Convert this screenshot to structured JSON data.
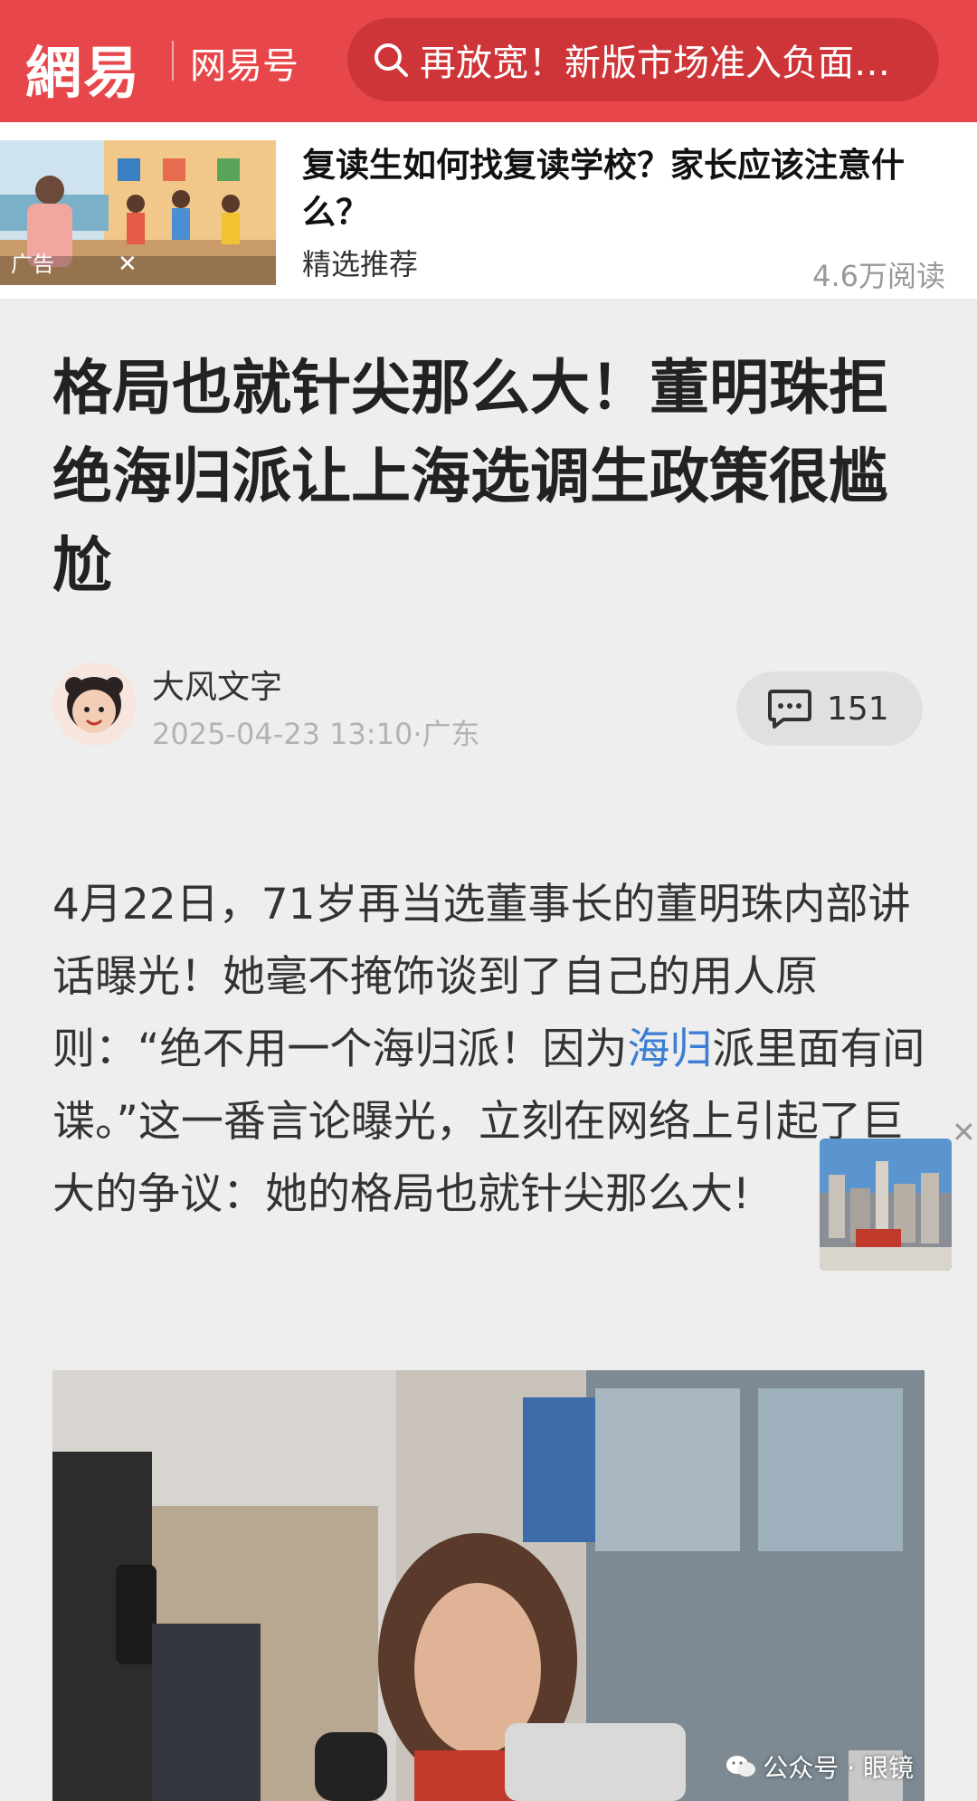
{
  "header": {
    "logo": "網易",
    "channel": "网易号",
    "search_text": "再放宽！新版市场准入负面…"
  },
  "ad": {
    "tag": "广告",
    "close": "✕",
    "title": "复读生如何找复读学校？家长应该注意什么？",
    "source": "精选推荐",
    "reads": "4.6万阅读"
  },
  "article": {
    "title": "格局也就针尖那么大！董明珠拒绝海归派让上海选调生政策很尴尬",
    "author": "大风文字",
    "meta": "2025-04-23 13:10·广东",
    "comment_count": "151",
    "body_before_link": "4月22日，71岁再当选董事长的董明珠内部讲话曝光！她毫不掩饰谈到了自己的用人原则：“绝不用一个海归派！因为",
    "body_link": "海归",
    "body_after_link": "派里面有间谍。”这一番言论曝光，立刻在网络上引起了巨大的争议：她的格局也就针尖那么大!"
  },
  "float": {
    "close": "✕"
  },
  "watermark": {
    "text": "公众号 · 眼镜"
  },
  "colors": {
    "brand_red": "#e7474a",
    "link_blue": "#3b7ed3"
  }
}
